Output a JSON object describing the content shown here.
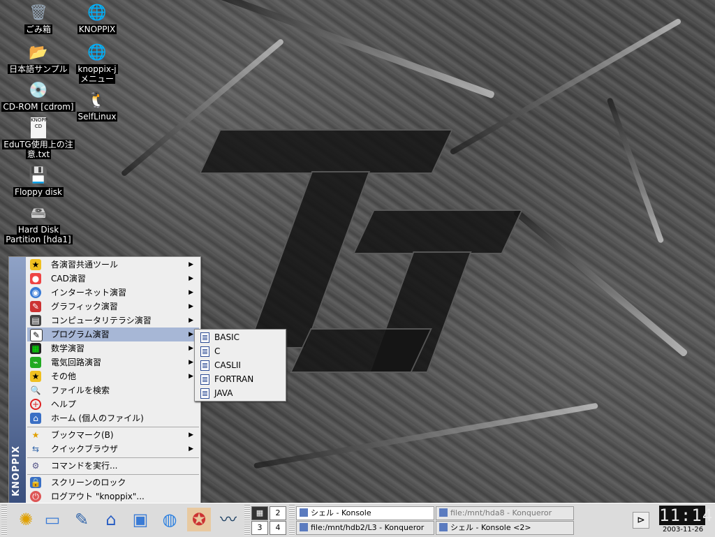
{
  "desktop": {
    "icons": [
      {
        "label": "ごみ箱",
        "icon": "trash-icon"
      },
      {
        "label": "KNOPPIX",
        "icon": "globe-doc-icon"
      },
      {
        "label": "日本語サンプル",
        "icon": "folder-icon"
      },
      {
        "label": "knoppix-j",
        "label2": "メニュー",
        "icon": "globe-doc-icon"
      },
      {
        "label": "CD-ROM [cdrom]",
        "icon": "cdrom-icon"
      },
      {
        "label": "SelfLinux",
        "icon": "tux-icon"
      },
      {
        "label": "EduTG使用上の注",
        "label2": "意.txt",
        "icon": "text-file-icon",
        "thumb_text": "KNOPP CD"
      },
      {
        "label": "Floppy disk",
        "icon": "floppy-icon"
      },
      {
        "label": "Hard Disk",
        "label2": "Partition [hda1]",
        "icon": "harddisk-icon"
      }
    ]
  },
  "start_menu": {
    "side_label": "KNOPPIX",
    "items": [
      {
        "label": "各演習共通ツール",
        "icon": "star-folder-icon",
        "submenu": true
      },
      {
        "label": "CAD演習",
        "icon": "cad-icon",
        "submenu": true
      },
      {
        "label": "インターネット演習",
        "icon": "internet-icon",
        "submenu": true
      },
      {
        "label": "グラフィック演習",
        "icon": "graphics-icon",
        "submenu": true
      },
      {
        "label": "コンピュータリテラシ演習",
        "icon": "printer-icon",
        "submenu": true
      },
      {
        "label": "プログラム演習",
        "icon": "program-icon",
        "submenu": true,
        "selected": true
      },
      {
        "label": "数学演習",
        "icon": "math-icon",
        "submenu": true
      },
      {
        "label": "電気回路演習",
        "icon": "circuit-icon",
        "submenu": true
      },
      {
        "label": "その他",
        "icon": "other-icon",
        "submenu": true
      },
      {
        "label": "ファイルを検索",
        "icon": "search-icon",
        "submenu": false
      },
      {
        "label": "ヘルプ",
        "icon": "help-icon",
        "submenu": false
      },
      {
        "label": "ホーム (個人のファイル)",
        "icon": "home-icon",
        "submenu": false
      },
      {
        "label": "ブックマーク(B)",
        "icon": "bookmark-icon",
        "submenu": true
      },
      {
        "label": "クイックブラウザ",
        "icon": "quickbrowser-icon",
        "submenu": true
      },
      {
        "label": "コマンドを実行...",
        "icon": "run-icon",
        "submenu": false
      },
      {
        "label": "スクリーンのロック",
        "icon": "lock-icon",
        "submenu": false
      },
      {
        "label": "ログアウト \"knoppix\"...",
        "icon": "logout-icon",
        "submenu": false
      }
    ]
  },
  "submenu": {
    "items": [
      "BASIC",
      "C",
      "CASLII",
      "FORTRAN",
      "JAVA"
    ]
  },
  "taskbar": {
    "launchers": [
      "kmenu-icon",
      "window-list-icon",
      "desktop-icon",
      "home-icon",
      "kcontrol-icon",
      "konqueror-icon",
      "kde-app-icon",
      "openoffice-icon"
    ],
    "pager": [
      "1",
      "2",
      "3",
      "4"
    ],
    "tasks": [
      {
        "label": "シェル - Konsole",
        "active": true
      },
      {
        "label": "file:/mnt/hda8 - Konqueror",
        "active": false,
        "dim": true
      },
      {
        "label": "file:/mnt/hdb2/L3 - Konqueror",
        "active": false
      },
      {
        "label": "シェル - Konsole <2>",
        "active": false
      }
    ],
    "clock": {
      "time": "11:14",
      "date": "2003-11-26"
    }
  },
  "colors": {
    "menu_bg": "#eeeeee",
    "menu_selected": "#a7b7d6",
    "side_bar": "#3a4f7d",
    "taskbar": "#dcdcdc"
  }
}
